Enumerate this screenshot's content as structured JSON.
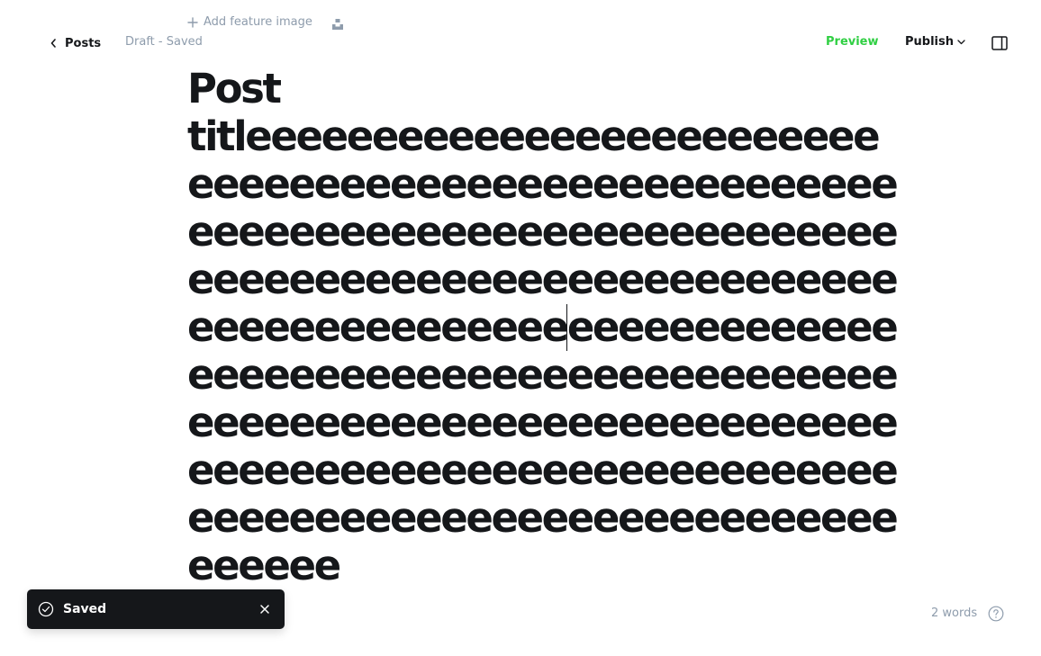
{
  "nav": {
    "back_label": "Posts",
    "status": "Draft - Saved"
  },
  "feature_image": {
    "label": "Add feature image"
  },
  "actions": {
    "preview_label": "Preview",
    "publish_label": "Publish"
  },
  "editor": {
    "title_lines": [
      "Post",
      "titleeeeeeeeeeeeeeeeeeeeeeeee",
      "eeeeeeeeeeeeeeeeeeeeeeeeeeee",
      "eeeeeeeeeeeeeeeeeeeeeeeeeeee",
      "eeeeeeeeeeeeeeeeeeeeeeeeeeee",
      "eeeeeeeeeeeeeeeeeeeeeeeeeeee",
      "eeeeeeeeeeeeeeeeeeeeeeeeeeee",
      "eeeeeeeeeeeeeeeeeeeeeeeeeeee",
      "eeeeeeeeeeeeeeeeeeeeeeeeeeee",
      "eeeeeeeeeeeeeeeeeeeeeeeeeeee",
      "eeeeee"
    ],
    "caret_line": 5,
    "caret_split_before": "eeeeeeeeeeeeeee",
    "caret_split_after": "eeeeeeeeeeeee"
  },
  "toast": {
    "message": "Saved"
  },
  "footer": {
    "word_count": "2 words"
  },
  "colors": {
    "accent_green": "#30cf43",
    "muted_text": "#8e9cac",
    "dark": "#15171a"
  },
  "icons": {
    "back": "chevron-left-icon",
    "feature_add": "plus-icon",
    "unsplash": "unsplash-icon",
    "publish_dropdown": "chevron-down-icon",
    "sidebar": "sidebar-toggle-icon",
    "toast_status": "check-circle-icon",
    "toast_close": "close-icon",
    "help": "help-circle-icon"
  }
}
